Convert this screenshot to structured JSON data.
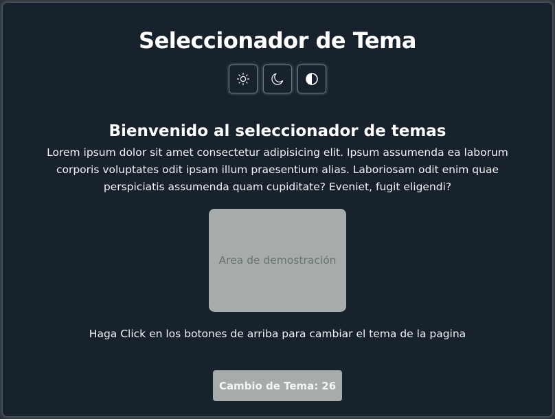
{
  "page": {
    "title": "Seleccionador de Tema"
  },
  "theme_buttons": [
    {
      "icon": "sun-icon",
      "label": "light"
    },
    {
      "icon": "moon-icon",
      "label": "dark"
    },
    {
      "icon": "contrast-icon",
      "label": "contrast"
    }
  ],
  "content": {
    "subtitle": "Bienvenido al seleccionador de temas",
    "lorem": "Lorem ipsum dolor sit amet consectetur adipisicing elit. Ipsum assumenda ea laborum corporis voluptates odit ipsam illum praesentium alias. Laboriosam odit enim quae perspiciatis assumenda quam cupiditate? Eveniet, fugit eligendi?",
    "demo_area_label": "Area de demostración",
    "instruction": "Haga Click en los botones de arriba para cambiar el tema de la pagina"
  },
  "counter": {
    "label": "Cambio de Tema:",
    "value": "26"
  },
  "colors": {
    "background": "#17222d",
    "text": "#ffffff",
    "demo_area": "#a5acab",
    "demo_text": "#6b7372"
  }
}
